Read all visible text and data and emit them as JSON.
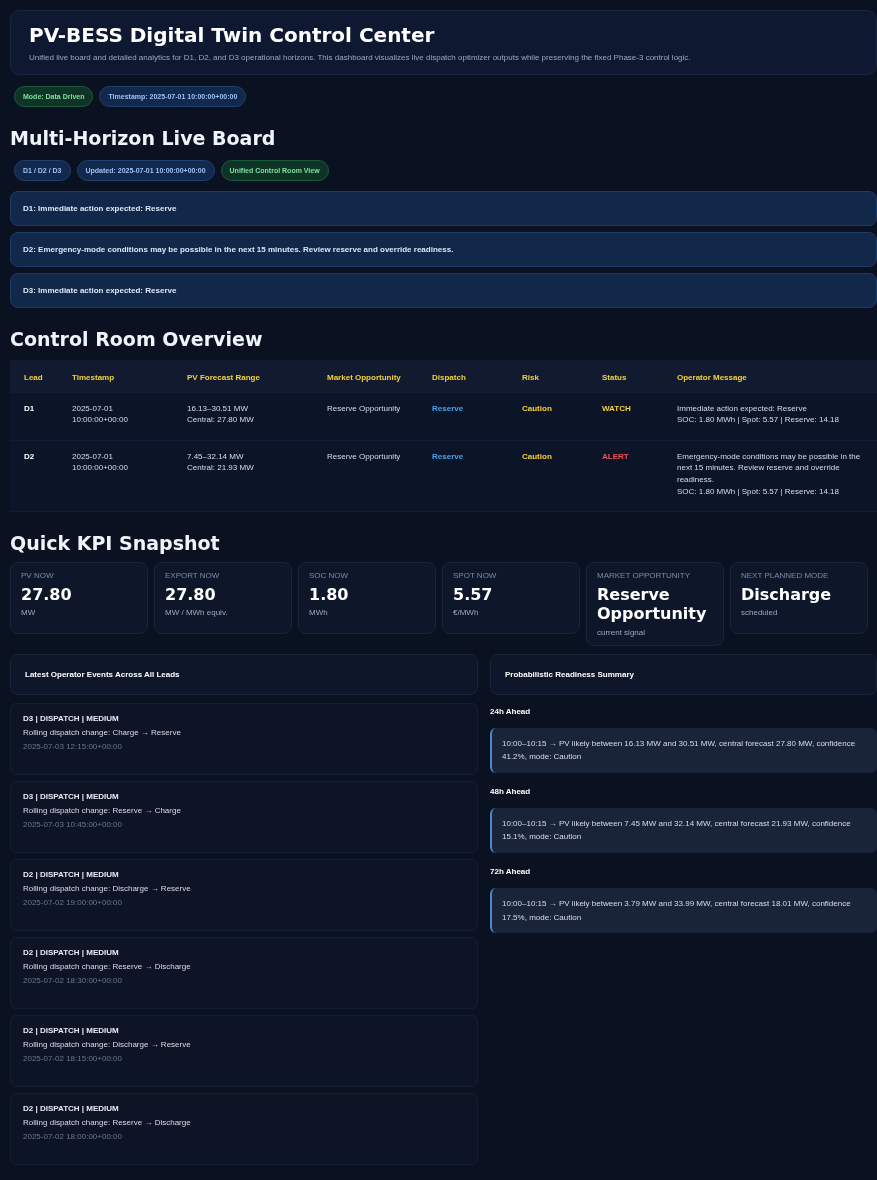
{
  "header": {
    "title": "PV-BESS Digital Twin Control Center",
    "subtitle": "Unified live board and detailed analytics for D1, D2, and D3 operational horizons. This dashboard visualizes live dispatch optimizer outputs while preserving the fixed Phase-3 control logic."
  },
  "header_badges": [
    {
      "text": "Mode: Data Driven",
      "kind": "green"
    },
    {
      "text": "Timestamp: 2025-07-01 10:00:00+00:00",
      "kind": "blue"
    }
  ],
  "live_board": {
    "title": "Multi-Horizon Live Board",
    "badges": [
      {
        "text": "D1 / D2 / D3",
        "kind": "blue"
      },
      {
        "text": "Updated: 2025-07-01 10:00:00+00:00",
        "kind": "blue"
      },
      {
        "text": "Unified Control Room View",
        "kind": "green"
      }
    ],
    "alerts": [
      "D1: Immediate action expected: Reserve",
      "D2: Emergency-mode conditions may be possible in the next 15 minutes. Review reserve and override readiness.",
      "D3: Immediate action expected: Reserve"
    ]
  },
  "overview": {
    "title": "Control Room Overview",
    "columns": [
      "Lead",
      "Timestamp",
      "PV Forecast Range",
      "Market Opportunity",
      "Dispatch",
      "Risk",
      "Status",
      "Operator Message"
    ],
    "rows": [
      {
        "lead": "D1",
        "timestamp": [
          "2025-07-01",
          "10:00:00+00:00"
        ],
        "range": [
          "16.13–30.51 MW",
          "Central: 27.80 MW"
        ],
        "market": "Reserve Opportunity",
        "dispatch": "Reserve",
        "risk": "Caution",
        "status": {
          "text": "WATCH",
          "color": "#f5d13a"
        },
        "message": [
          "Immediate action expected: Reserve",
          "SOC: 1.80 MWh | Spot: 5.57 | Reserve: 14.18"
        ]
      },
      {
        "lead": "D2",
        "timestamp": [
          "2025-07-01",
          "10:00:00+00:00"
        ],
        "range": [
          "7.45–32.14 MW",
          "Central: 21.93 MW"
        ],
        "market": "Reserve Opportunity",
        "dispatch": "Reserve",
        "risk": "Caution",
        "status": {
          "text": "ALERT",
          "color": "#f0505a"
        },
        "message": [
          "Emergency-mode conditions may be possible in the next 15 minutes. Review reserve and override readiness.",
          "SOC: 1.80 MWh | Spot: 5.57 | Reserve: 14.18"
        ]
      }
    ]
  },
  "kpi": {
    "title": "Quick KPI Snapshot",
    "cards": [
      {
        "label": "PV NOW",
        "value": "27.80",
        "unit": "MW"
      },
      {
        "label": "EXPORT NOW",
        "value": "27.80",
        "unit": "MW / MWh equiv."
      },
      {
        "label": "SOC NOW",
        "value": "1.80",
        "unit": "MWh"
      },
      {
        "label": "SPOT NOW",
        "value": "5.57",
        "unit": "€/MWh"
      },
      {
        "label": "MARKET OPPORTUNITY",
        "value": "Reserve Opportunity",
        "unit": "current signal"
      },
      {
        "label": "NEXT PLANNED MODE",
        "value": "Discharge",
        "unit": "scheduled"
      }
    ]
  },
  "events": {
    "title": "Latest Operator Events Across All Leads",
    "items": [
      {
        "head": "D3 | DISPATCH | MEDIUM",
        "text": "Rolling dispatch change: Charge → Reserve",
        "time": "2025-07-03 12:15:00+00:00"
      },
      {
        "head": "D3 | DISPATCH | MEDIUM",
        "text": "Rolling dispatch change: Reserve → Charge",
        "time": "2025-07-03 10:45:00+00:00"
      },
      {
        "head": "D2 | DISPATCH | MEDIUM",
        "text": "Rolling dispatch change: Discharge → Reserve",
        "time": "2025-07-02 19:00:00+00:00"
      },
      {
        "head": "D2 | DISPATCH | MEDIUM",
        "text": "Rolling dispatch change: Reserve → Discharge",
        "time": "2025-07-02 18:30:00+00:00"
      },
      {
        "head": "D2 | DISPATCH | MEDIUM",
        "text": "Rolling dispatch change: Discharge → Reserve",
        "time": "2025-07-02 18:15:00+00:00"
      },
      {
        "head": "D2 | DISPATCH | MEDIUM",
        "text": "Rolling dispatch change: Reserve → Discharge",
        "time": "2025-07-02 18:00:00+00:00"
      }
    ]
  },
  "readiness": {
    "title": "Probabilistic Readiness Summary",
    "groups": [
      {
        "heading": "24h Ahead",
        "text": "10:00–10:15 → PV likely between 16.13 MW and 30.51 MW, central forecast 27.80 MW, confidence 41.2%, mode: Caution"
      },
      {
        "heading": "48h Ahead",
        "text": "10:00–10:15 → PV likely between 7.45 MW and 32.14 MW, central forecast 21.93 MW, confidence 15.1%, mode: Caution"
      },
      {
        "heading": "72h Ahead",
        "text": "10:00–10:15 → PV likely between 3.79 MW and 33.99 MW, central forecast 18.01 MW, confidence 17.5%, mode: Caution"
      }
    ]
  }
}
